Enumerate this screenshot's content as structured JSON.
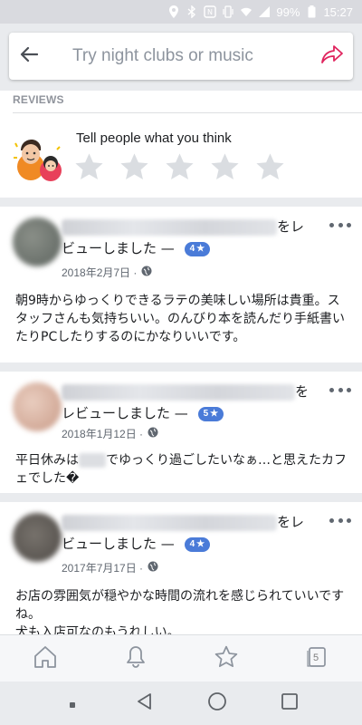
{
  "status_bar": {
    "battery_percent": "99%",
    "time": "15:27",
    "icons": [
      "location-icon",
      "bluetooth-icon",
      "nfc-icon",
      "vibrate-icon",
      "wifi-icon",
      "signal-icon",
      "battery-icon"
    ]
  },
  "search": {
    "placeholder": "Try night clubs or music",
    "back_icon": "back-arrow-icon",
    "share_icon": "share-icon"
  },
  "reviews_section": {
    "label": "REVIEWS",
    "prompt": "Tell people what you think",
    "star_count": 5
  },
  "reviews": [
    {
      "header_suffix_a": "をレ",
      "header_suffix_b": "ビューしました —",
      "rating": "4",
      "date": "2018年2月7日 ·",
      "body": "朝9時からゆっくりできるラテの美味しい場所は貴重。スタッフさんも気持ちいい。のんびり本を読んだり手紙書いたりPCしたりするのにかなりいいです。"
    },
    {
      "header_suffix_a": "を",
      "header_suffix_b": "レビューしました —",
      "rating": "5",
      "date": "2018年1月12日 ·",
      "body_prefix": "平日休みは",
      "body_suffix": "でゆっくり過ごしたいなぁ…と思えたカフェでした�"
    },
    {
      "header_suffix_a": "をレ",
      "header_suffix_b": "ビューしました —",
      "rating": "4",
      "date": "2017年7月17日 ·",
      "body_line1": "お店の雰囲気が穏やかな時間の流れを感じられていいですね。",
      "body_line2": "犬も入店可なのもうれしい。"
    }
  ],
  "tabbar": {
    "items": [
      "home-icon",
      "bell-icon",
      "star-icon",
      "tabs-icon"
    ],
    "tabs_count": "5"
  },
  "navbar": {
    "items": [
      "dot-icon",
      "back-triangle-icon",
      "home-circle-icon",
      "recents-square-icon"
    ]
  },
  "colors": {
    "accent_blue": "#4a7bd8",
    "share_red": "#e0245e",
    "background": "#e9ebee"
  }
}
